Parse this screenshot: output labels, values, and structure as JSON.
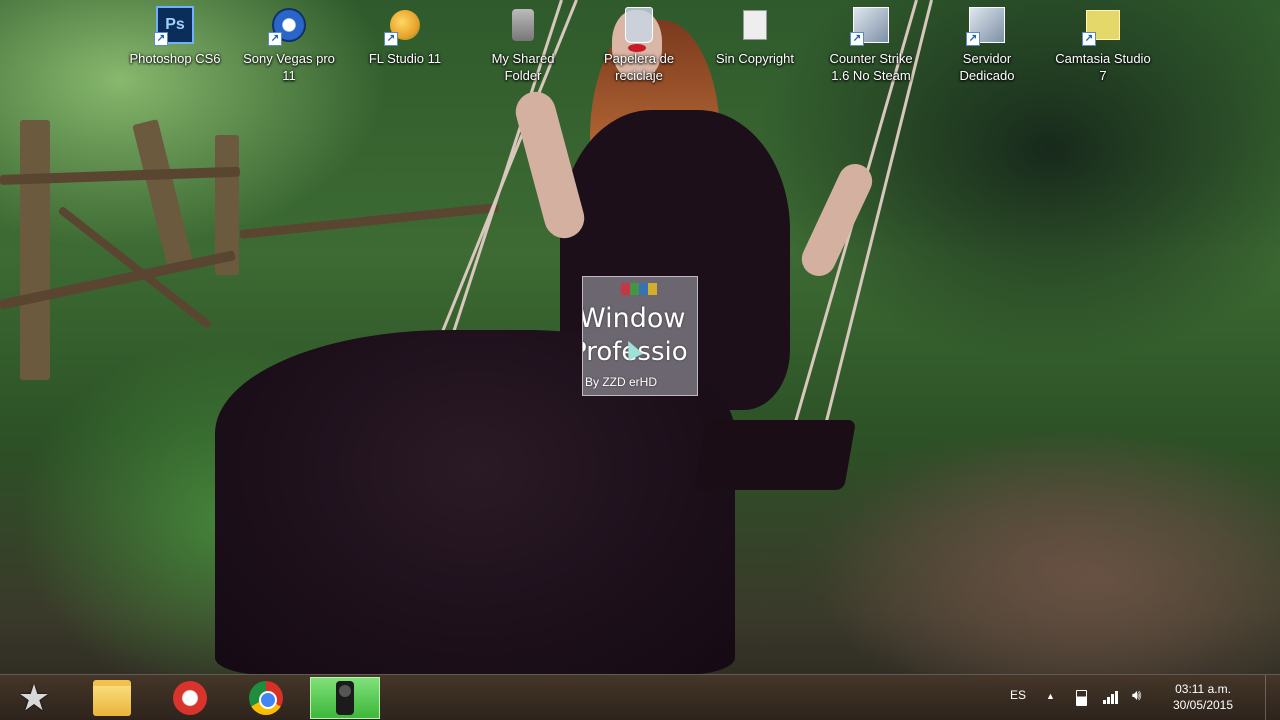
{
  "desktop": {
    "icons": [
      {
        "label": "Photoshop CS6",
        "icon": "photoshop-icon",
        "glyph": "Ps",
        "color": "#0b3a73"
      },
      {
        "label": "Sony Vegas pro\n11",
        "icon": "sony-vegas-icon",
        "glyph": "◉",
        "color": "#2a66c9"
      },
      {
        "label": "FL Studio 11",
        "icon": "fl-studio-icon",
        "glyph": "🍊",
        "color": "#e6a22a"
      },
      {
        "label": "My Shared\nFolder",
        "icon": "shared-folder-icon",
        "glyph": "🔊",
        "color": "#888888"
      },
      {
        "label": "Papelera de\nreciclaje",
        "icon": "recycle-bin-icon",
        "glyph": "🗑",
        "color": "#9ab"
      },
      {
        "label": "Sin Copyright",
        "icon": "file-icon",
        "glyph": "▭",
        "color": "#cccccc"
      },
      {
        "label": "Counter Strike\n1.6 No Steam",
        "icon": "counter-strike-icon",
        "glyph": "🎯",
        "color": "#4d6b8a"
      },
      {
        "label": "Servidor\nDedicado",
        "icon": "server-icon",
        "glyph": "🎯",
        "color": "#4d6b8a"
      },
      {
        "label": "Camtasia Studio\n7",
        "icon": "camtasia-icon",
        "glyph": "▦",
        "color": "#d9c84a"
      }
    ],
    "drag_tile": {
      "line1": "Window",
      "line2": "Professio",
      "line3": "By  ZZD erHD"
    }
  },
  "taskbar": {
    "buttons": [
      {
        "name": "start-button",
        "icon": "star-icon",
        "glyph": "★",
        "color": "#cfcfcf"
      },
      {
        "name": "explorer-button",
        "icon": "folder-icon",
        "glyph": "📁",
        "color": "#f2c14e"
      },
      {
        "name": "ccleaner-button",
        "icon": "ccleaner-icon",
        "glyph": "C",
        "color": "#d9342b"
      },
      {
        "name": "chrome-button",
        "icon": "chrome-icon",
        "glyph": "◉",
        "color": "#2e9b44"
      },
      {
        "name": "recorder-button",
        "icon": "camera-icon",
        "glyph": "🎥",
        "color": "#333333"
      }
    ],
    "tray": {
      "language": "ES",
      "show_hidden": "▲",
      "clock_time": "03:11 a.m.",
      "clock_date": "30/05/2015"
    }
  }
}
